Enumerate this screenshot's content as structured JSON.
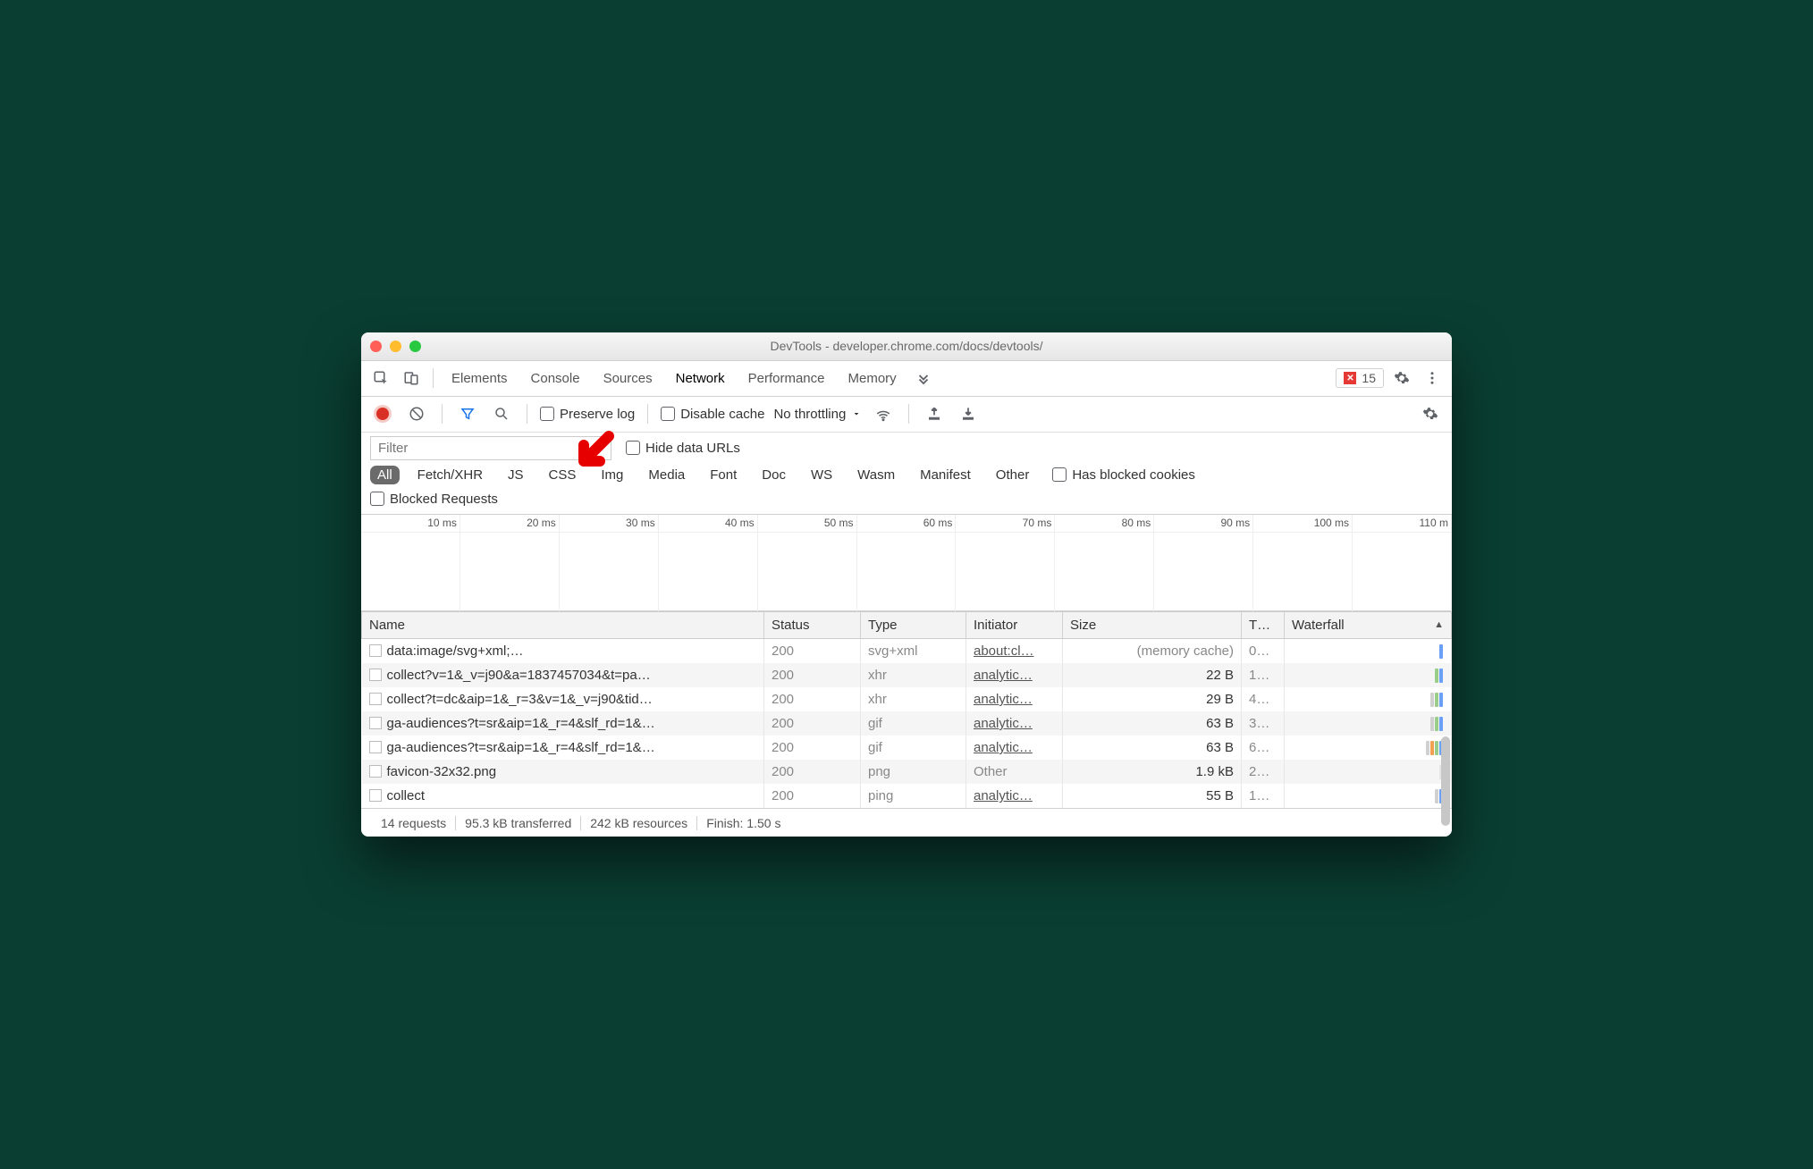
{
  "window": {
    "title": "DevTools - developer.chrome.com/docs/devtools/"
  },
  "panelTabs": {
    "items": [
      "Elements",
      "Console",
      "Sources",
      "Network",
      "Performance",
      "Memory"
    ],
    "active": "Network",
    "errorCount": "15"
  },
  "netToolbar": {
    "preserveLog": "Preserve log",
    "disableCache": "Disable cache",
    "throttling": "No throttling"
  },
  "filter": {
    "placeholder": "Filter",
    "hideDataUrls": "Hide data URLs"
  },
  "typeFilters": {
    "items": [
      "All",
      "Fetch/XHR",
      "JS",
      "CSS",
      "Img",
      "Media",
      "Font",
      "Doc",
      "WS",
      "Wasm",
      "Manifest",
      "Other"
    ],
    "active": "All",
    "hasBlockedCookies": "Has blocked cookies",
    "blockedRequests": "Blocked Requests"
  },
  "overview": {
    "ticks": [
      "10 ms",
      "20 ms",
      "30 ms",
      "40 ms",
      "50 ms",
      "60 ms",
      "70 ms",
      "80 ms",
      "90 ms",
      "100 ms",
      "110 m"
    ]
  },
  "table": {
    "columns": [
      "Name",
      "Status",
      "Type",
      "Initiator",
      "Size",
      "T…",
      "Waterfall"
    ],
    "rows": [
      {
        "name": "data:image/svg+xml;…",
        "status": "200",
        "type": "svg+xml",
        "initiator": "about:cl…",
        "initiatorClass": "link",
        "size": "(memory cache)",
        "sizeClass": "muted",
        "time": "0…",
        "wf": [
          "#6aa0f8"
        ],
        "iconDoc": true
      },
      {
        "name": "collect?v=1&_v=j90&a=1837457034&t=pa…",
        "status": "200",
        "type": "xhr",
        "initiator": "analytic…",
        "initiatorClass": "link",
        "size": "22 B",
        "time": "1…",
        "wf": [
          "#9acd8a",
          "#6aa0f8"
        ]
      },
      {
        "name": "collect?t=dc&aip=1&_r=3&v=1&_v=j90&tid…",
        "status": "200",
        "type": "xhr",
        "initiator": "analytic…",
        "initiatorClass": "link",
        "size": "29 B",
        "time": "4…",
        "wf": [
          "#d0d0d0",
          "#9acd8a",
          "#6aa0f8"
        ]
      },
      {
        "name": "ga-audiences?t=sr&aip=1&_r=4&slf_rd=1&…",
        "status": "200",
        "type": "gif",
        "initiator": "analytic…",
        "initiatorClass": "link",
        "size": "63 B",
        "time": "3…",
        "wf": [
          "#d0d0d0",
          "#9acd8a",
          "#6aa0f8"
        ]
      },
      {
        "name": "ga-audiences?t=sr&aip=1&_r=4&slf_rd=1&…",
        "status": "200",
        "type": "gif",
        "initiator": "analytic…",
        "initiatorClass": "link",
        "size": "63 B",
        "time": "6…",
        "wf": [
          "#d0d0d0",
          "#f0a050",
          "#9acd8a",
          "#6aa0f8"
        ]
      },
      {
        "name": "favicon-32x32.png",
        "status": "200",
        "type": "png",
        "initiator": "Other",
        "initiatorClass": "muted",
        "size": "1.9 kB",
        "time": "2…",
        "wf": [
          "#e6e6e6"
        ]
      },
      {
        "name": "collect",
        "status": "200",
        "type": "ping",
        "initiator": "analytic…",
        "initiatorClass": "link",
        "size": "55 B",
        "time": "1…",
        "wf": [
          "#d0d0d0",
          "#6aa0f8"
        ]
      }
    ]
  },
  "statusBar": {
    "requests": "14 requests",
    "transferred": "95.3 kB transferred",
    "resources": "242 kB resources",
    "finish": "Finish: 1.50 s"
  }
}
